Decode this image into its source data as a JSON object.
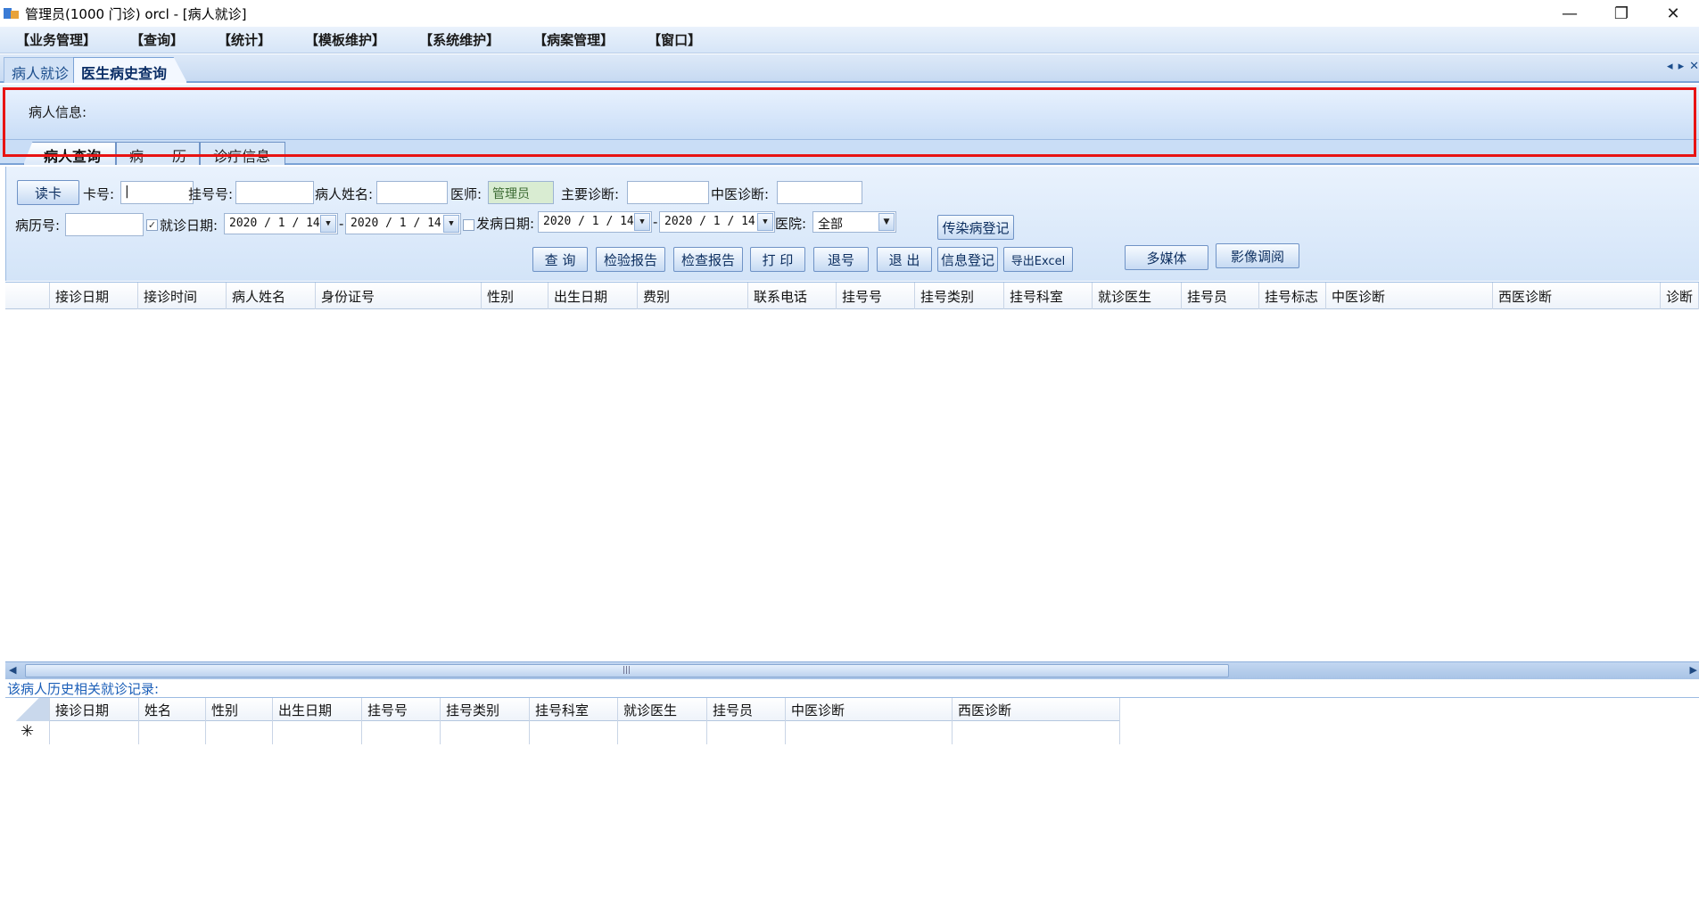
{
  "window": {
    "title": "管理员(1000 门诊)  orcl - [病人就诊]",
    "minimize": "—",
    "restore": "❐",
    "close": "✕"
  },
  "menu": [
    "【业务管理】",
    "【查询】",
    "【统计】",
    "【模板维护】",
    "【系统维护】",
    "【病案管理】",
    "【窗口】"
  ],
  "doc_tabs": [
    "病人就诊",
    "医生病史查询"
  ],
  "nav_arrows": [
    "◂",
    "▸",
    "✕"
  ],
  "patient_info_label": "病人信息:",
  "inner_tabs": [
    "病人查询",
    "病　　历",
    "诊疗信息"
  ],
  "query": {
    "read_card_button": "读卡",
    "card_label": "卡号:",
    "card_value": "|",
    "reg_no_label": "挂号号:",
    "patient_name_label": "病人姓名:",
    "doctor_label": "医师:",
    "doctor_value": "管理员",
    "main_diag_label": "主要诊断:",
    "tcm_diag_label": "中医诊断:",
    "record_no_label": "病历号:",
    "visit_date_checked": "✓",
    "visit_date_label": "就诊日期:",
    "visit_date_from": "2020 / 1 / 14",
    "dash": "-",
    "visit_date_to": "2020 / 1 / 14",
    "onset_date_label": "发病日期:",
    "onset_date_from": "2020 / 1 / 14",
    "onset_date_to": "2020 / 1 / 14",
    "hospital_label": "医院:",
    "hospital_value": "全部",
    "dropdown_arrow": "▼",
    "infectious_button": "传染病登记",
    "buttons": [
      "查 询",
      "检验报告",
      "检查报告",
      "打 印",
      "退号",
      "退 出",
      "信息登记",
      "导出Excel"
    ],
    "multimedia_button": "多媒体",
    "image_button": "影像调阅"
  },
  "main_grid": {
    "columns": [
      "",
      "接诊日期",
      "接诊时间",
      "病人姓名",
      "身份证号",
      "性别",
      "出生日期",
      "费别",
      "联系电话",
      "挂号号",
      "挂号类别",
      "挂号科室",
      "就诊医生",
      "挂号员",
      "挂号标志",
      "中医诊断",
      "西医诊断",
      "诊断"
    ]
  },
  "scrollbar": {
    "left": "◀",
    "right": "▶",
    "grip": "|||"
  },
  "history": {
    "label": "该病人历史相关就诊记录:",
    "columns": [
      "",
      "接诊日期",
      "姓名",
      "性别",
      "出生日期",
      "挂号号",
      "挂号类别",
      "挂号科室",
      "就诊医生",
      "挂号员",
      "中医诊断",
      "西医诊断"
    ],
    "new_row_marker": "✳"
  }
}
